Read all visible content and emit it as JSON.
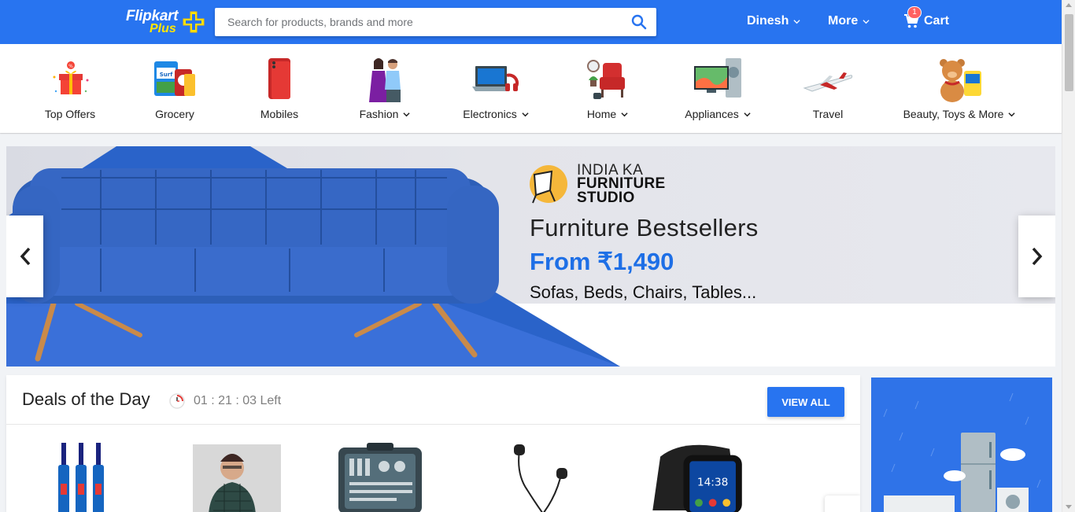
{
  "header": {
    "logo_word": "Flipkart",
    "logo_plus": "Plus",
    "search_placeholder": "Search for products, brands and more",
    "user_label": "Dinesh",
    "more_label": "More",
    "cart_label": "Cart",
    "cart_count": "1",
    "brand_color": "#2874f0",
    "accent_color": "#ffe500"
  },
  "categories": [
    {
      "label": "Top Offers",
      "icon": "gift-box-icon",
      "has_dropdown": false
    },
    {
      "label": "Grocery",
      "icon": "grocery-icon",
      "has_dropdown": false
    },
    {
      "label": "Mobiles",
      "icon": "mobile-phone-icon",
      "has_dropdown": false
    },
    {
      "label": "Fashion",
      "icon": "fashion-icon",
      "has_dropdown": true
    },
    {
      "label": "Electronics",
      "icon": "laptop-icon",
      "has_dropdown": true
    },
    {
      "label": "Home",
      "icon": "armchair-icon",
      "has_dropdown": true
    },
    {
      "label": "Appliances",
      "icon": "tv-appliance-icon",
      "has_dropdown": true
    },
    {
      "label": "Travel",
      "icon": "airplane-icon",
      "has_dropdown": false
    },
    {
      "label": "Beauty, Toys & More",
      "icon": "teddy-bear-icon",
      "has_dropdown": true
    }
  ],
  "banner": {
    "studio_line1": "INDIA KA",
    "studio_line2a": "FURNITURE",
    "studio_line2b": "STUDIO",
    "title": "Furniture Bestsellers",
    "price": "From ₹1,490",
    "subtitle": "Sofas, Beds, Chairs, Tables...",
    "sofa_color": "#2e5fb5",
    "price_color": "#1e6fe6"
  },
  "deals": {
    "title": "Deals of the Day",
    "timer": "01 : 21 : 03 Left",
    "view_all": "VIEW ALL",
    "items": [
      {
        "icon": "cricket-bat-icon"
      },
      {
        "icon": "shirt-icon"
      },
      {
        "icon": "toolkit-icon"
      },
      {
        "icon": "earphones-icon"
      },
      {
        "icon": "smartwatch-icon"
      }
    ]
  },
  "smartwatch": {
    "time": "14:38"
  },
  "side_ad": {
    "icon": "appliance-ad-icon"
  }
}
